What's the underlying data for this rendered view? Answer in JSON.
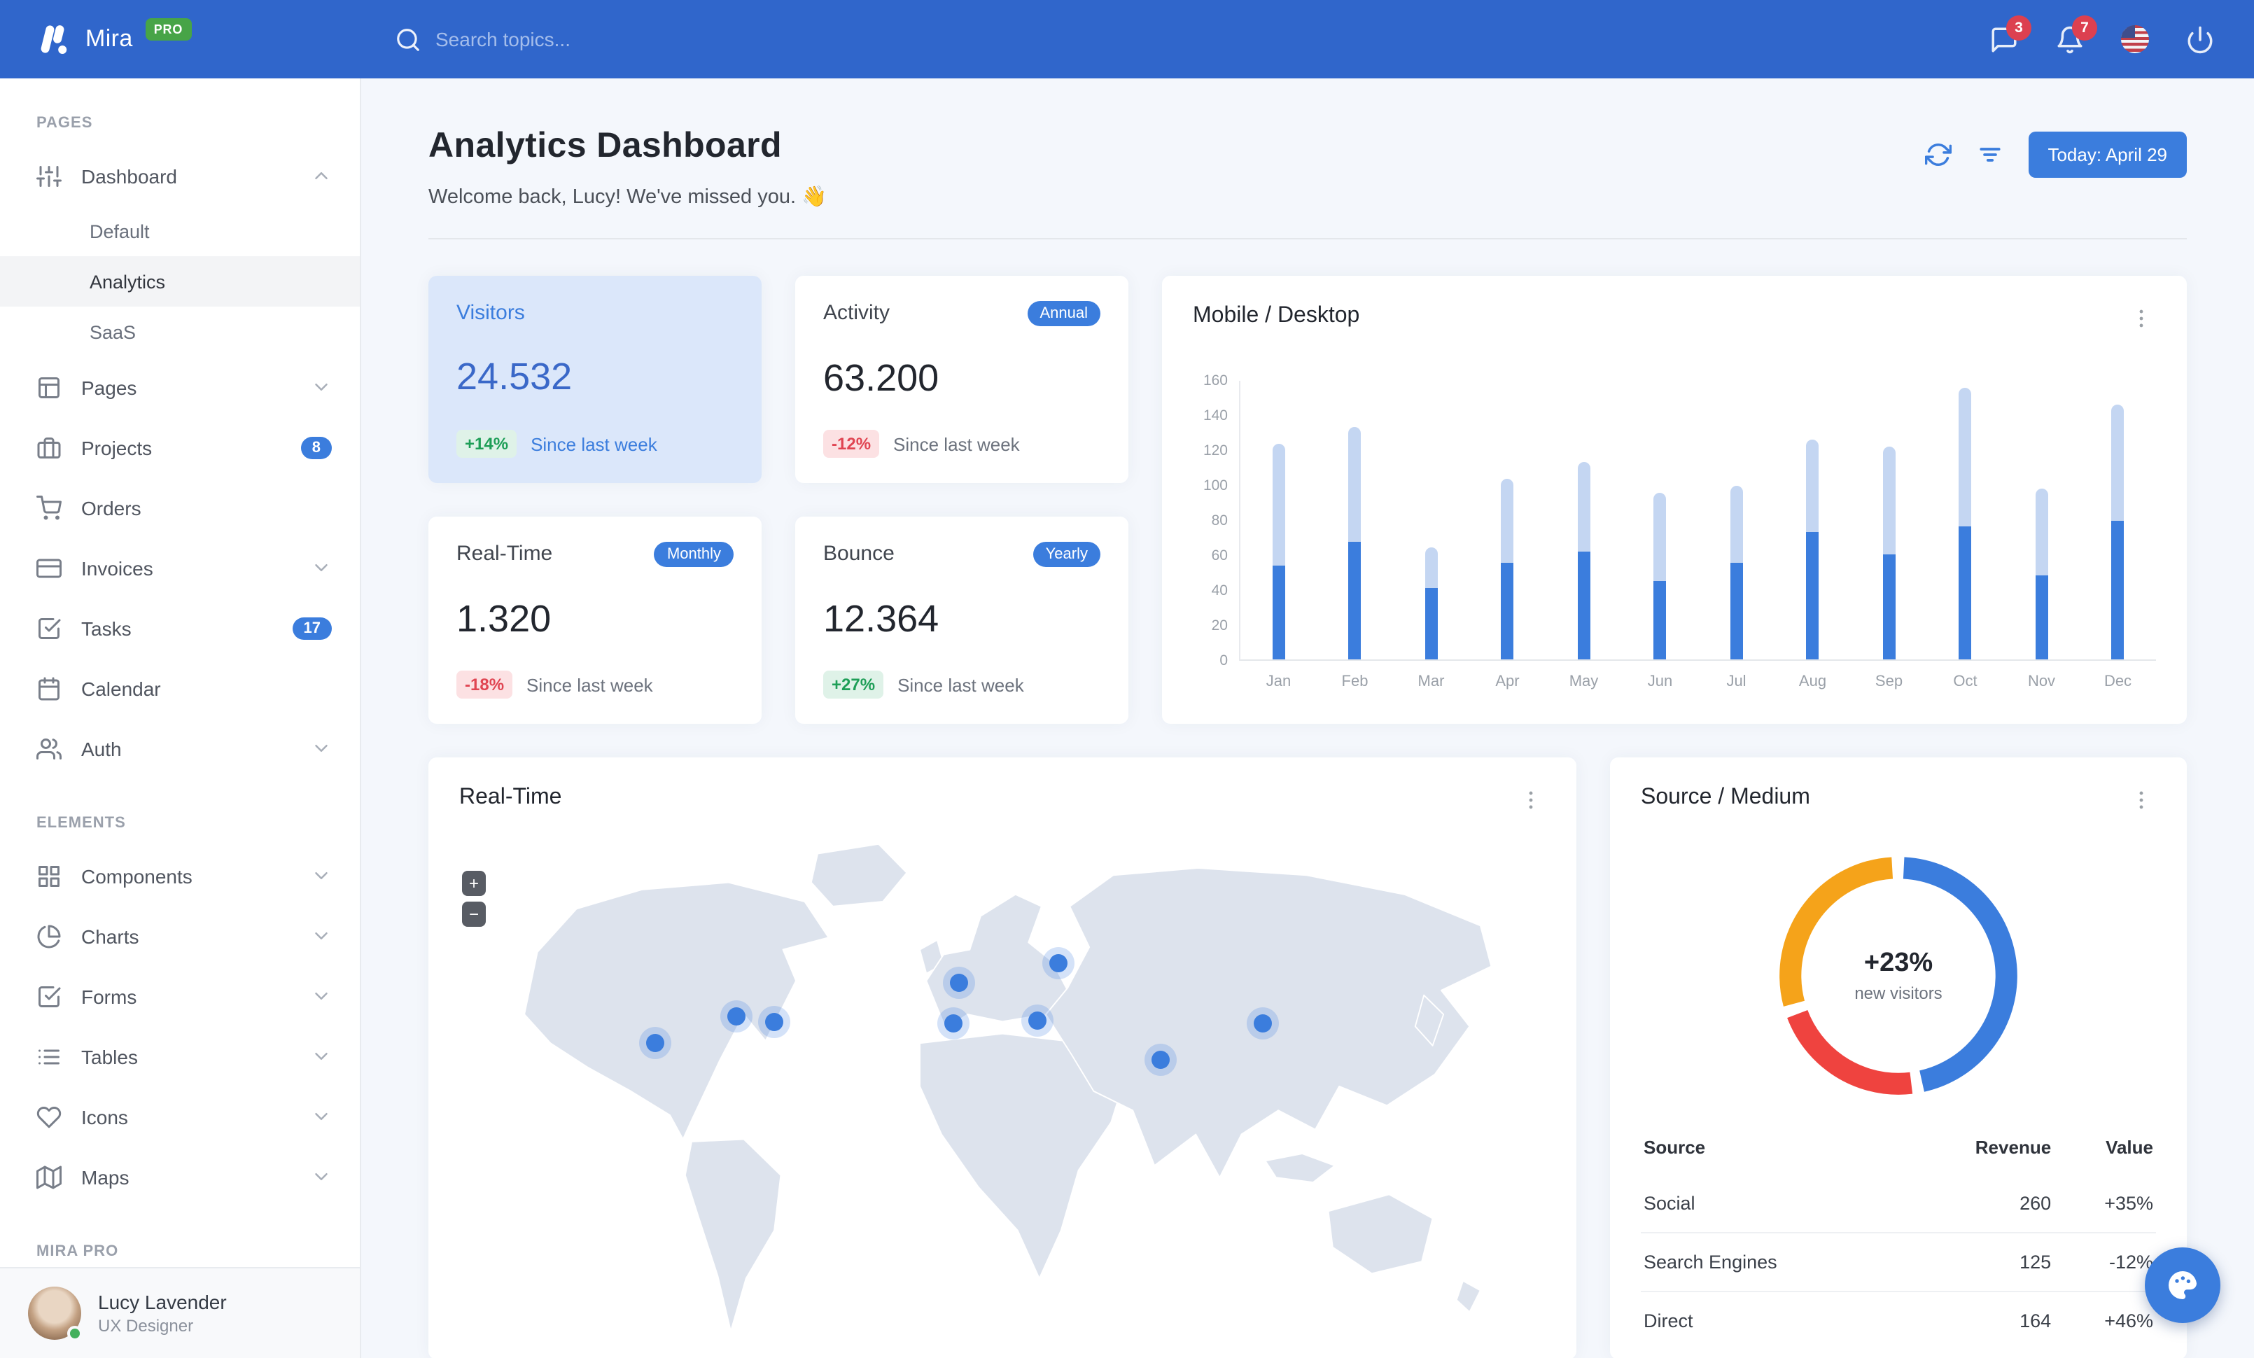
{
  "navbar": {
    "brand": "Mira",
    "brand_badge": "PRO",
    "search_placeholder": "Search topics...",
    "messages_badge": "3",
    "alerts_badge": "7"
  },
  "sidebar": {
    "sections": [
      {
        "label": "PAGES",
        "items": [
          {
            "label": "Dashboard",
            "icon": "sliders",
            "chevron": "up",
            "expanded": true,
            "children": [
              {
                "label": "Default",
                "active": false
              },
              {
                "label": "Analytics",
                "active": true
              },
              {
                "label": "SaaS",
                "active": false
              }
            ]
          },
          {
            "label": "Pages",
            "icon": "layout",
            "chevron": "down"
          },
          {
            "label": "Projects",
            "icon": "briefcase",
            "badge": "8"
          },
          {
            "label": "Orders",
            "icon": "cart"
          },
          {
            "label": "Invoices",
            "icon": "credit-card",
            "chevron": "down"
          },
          {
            "label": "Tasks",
            "icon": "check-square",
            "badge": "17"
          },
          {
            "label": "Calendar",
            "icon": "calendar"
          },
          {
            "label": "Auth",
            "icon": "users",
            "chevron": "down"
          }
        ]
      },
      {
        "label": "ELEMENTS",
        "items": [
          {
            "label": "Components",
            "icon": "grid",
            "chevron": "down"
          },
          {
            "label": "Charts",
            "icon": "pie-chart",
            "chevron": "down"
          },
          {
            "label": "Forms",
            "icon": "check-square",
            "chevron": "down"
          },
          {
            "label": "Tables",
            "icon": "list",
            "chevron": "down"
          },
          {
            "label": "Icons",
            "icon": "heart",
            "chevron": "down"
          },
          {
            "label": "Maps",
            "icon": "map",
            "chevron": "down"
          }
        ]
      },
      {
        "label": "MIRA PRO",
        "items": []
      }
    ],
    "user": {
      "name": "Lucy Lavender",
      "role": "UX Designer"
    }
  },
  "header": {
    "title": "Analytics Dashboard",
    "welcome": "Welcome back, Lucy! We've missed you. 👋",
    "today_button": "Today: April 29"
  },
  "stats": [
    {
      "title": "Visitors",
      "badge": "",
      "value": "24.532",
      "delta": "+14%",
      "delta_dir": "up",
      "note": "Since last week",
      "highlight": true
    },
    {
      "title": "Activity",
      "badge": "Annual",
      "value": "63.200",
      "delta": "-12%",
      "delta_dir": "down",
      "note": "Since last week",
      "highlight": false
    },
    {
      "title": "Real-Time",
      "badge": "Monthly",
      "value": "1.320",
      "delta": "-18%",
      "delta_dir": "down",
      "note": "Since last week",
      "highlight": false
    },
    {
      "title": "Bounce",
      "badge": "Yearly",
      "value": "12.364",
      "delta": "+27%",
      "delta_dir": "up",
      "note": "Since last week",
      "highlight": false
    }
  ],
  "chart_data": [
    {
      "id": "mobile-desktop",
      "type": "bar",
      "stacked": true,
      "title": "Mobile / Desktop",
      "categories": [
        "Jan",
        "Feb",
        "Mar",
        "Apr",
        "May",
        "Jun",
        "Jul",
        "Aug",
        "Sep",
        "Oct",
        "Nov",
        "Dec"
      ],
      "series": [
        {
          "name": "Mobile",
          "color": "#3b7ddd",
          "values": [
            54,
            67,
            41,
            55,
            62,
            45,
            55,
            73,
            60,
            76,
            48,
            79
          ]
        },
        {
          "name": "Desktop",
          "color": "#c4d6f2",
          "values": [
            69,
            66,
            23,
            48,
            51,
            50,
            44,
            53,
            62,
            79,
            50,
            67
          ]
        }
      ],
      "ylim": [
        0,
        160
      ],
      "ytick_step": 20,
      "grid": false,
      "legend_position": "none"
    },
    {
      "id": "source-medium",
      "type": "pie",
      "donut": true,
      "title": "Source / Medium",
      "labels": [
        "Social",
        "Search Engines",
        "Direct"
      ],
      "values": [
        260,
        125,
        164
      ],
      "colors": [
        "#3b7ddd",
        "#ef433f",
        "#f5a31a"
      ],
      "center_text": "+23%",
      "center_subtext": "new visitors",
      "legend_position": "none"
    }
  ],
  "map_card": {
    "title": "Real-Time",
    "zoom_in": "+",
    "zoom_out": "−",
    "markers": [
      {
        "x": 18.0,
        "y": 41.5
      },
      {
        "x": 25.5,
        "y": 36.0
      },
      {
        "x": 29.0,
        "y": 37.2
      },
      {
        "x": 46.0,
        "y": 29.5
      },
      {
        "x": 45.5,
        "y": 37.5
      },
      {
        "x": 55.2,
        "y": 25.5
      },
      {
        "x": 53.2,
        "y": 37.0
      },
      {
        "x": 64.5,
        "y": 44.8
      },
      {
        "x": 74.0,
        "y": 37.5
      }
    ]
  },
  "source_card": {
    "table": {
      "headers": [
        "Source",
        "Revenue",
        "Value"
      ],
      "rows": [
        {
          "source": "Social",
          "revenue": "260",
          "value": "+35%",
          "dir": "up"
        },
        {
          "source": "Search Engines",
          "revenue": "125",
          "value": "-12%",
          "dir": "down"
        },
        {
          "source": "Direct",
          "revenue": "164",
          "value": "+46%",
          "dir": "up"
        }
      ]
    }
  },
  "colors": {
    "navbar": "#3066cb",
    "primary": "#3b7ddd",
    "pro_badge_green": "#47a447",
    "notification_red": "#dc4050",
    "positive_green": "#1e9e57",
    "negative_red": "#e04552",
    "donut_blue": "#3b7ddd",
    "donut_red": "#ef433f",
    "donut_orange": "#f5a31a",
    "highlight_card_bg": "#dbe7fa"
  }
}
